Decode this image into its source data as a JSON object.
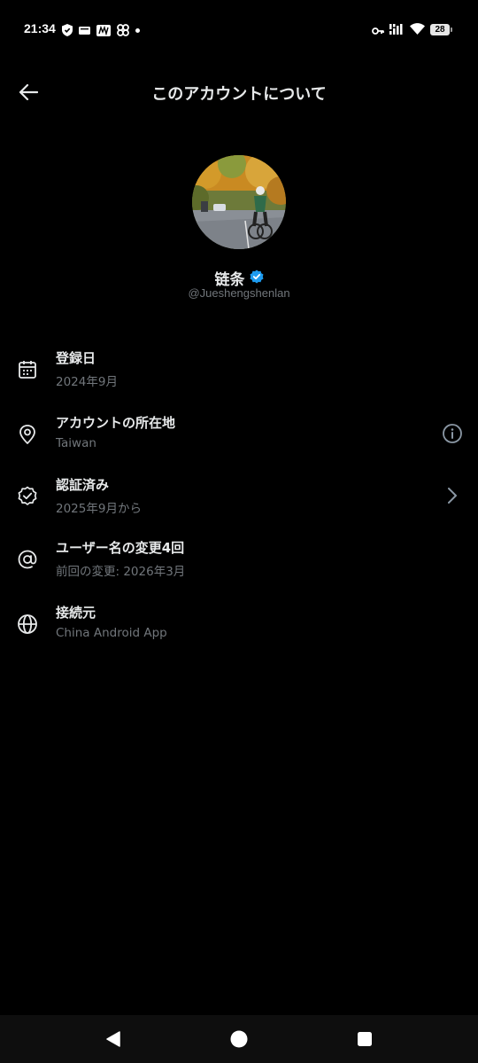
{
  "status_bar": {
    "time": "21:34",
    "battery_level": "28",
    "left_icons": [
      "shield-icon",
      "mail-icon",
      "news-icon",
      "pinwheel-icon",
      "dot-icon"
    ],
    "right_icons": [
      "key-icon",
      "signal-icon",
      "wifi-icon",
      "battery-icon"
    ]
  },
  "header": {
    "title": "このアカウントについて",
    "back_icon": "arrow-left-icon"
  },
  "profile": {
    "display_name": "链条",
    "handle": "@Jueshengshenlan",
    "verified": true,
    "verified_color": "#1d9bf0"
  },
  "info_rows": [
    {
      "icon": "calendar-icon",
      "title": "登録日",
      "subtitle": "2024年9月"
    },
    {
      "icon": "location-pin-icon",
      "title": "アカウントの所在地",
      "subtitle": "Taiwan",
      "trailing": "info-icon"
    },
    {
      "icon": "verified-badge-icon",
      "title": "認証済み",
      "subtitle": "2025年9月から",
      "trailing": "chevron-right-icon"
    },
    {
      "icon": "at-sign-icon",
      "title": "ユーザー名の変更4回",
      "subtitle": "前回の変更: 2026年3月"
    },
    {
      "icon": "globe-icon",
      "title": "接続元",
      "subtitle": "China Android App"
    }
  ],
  "nav_bar": {
    "buttons": [
      "back-triangle-icon",
      "home-circle-icon",
      "recents-square-icon"
    ]
  },
  "colors": {
    "background": "#000000",
    "primary_text": "#e7e9ea",
    "secondary_text": "#71767b",
    "accent": "#1d9bf0"
  }
}
